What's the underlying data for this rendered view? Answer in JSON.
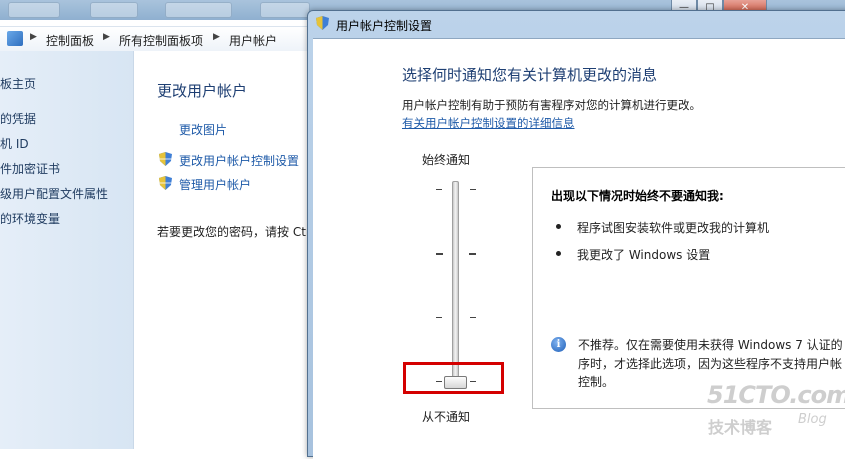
{
  "background_window": {
    "window_controls": {
      "minimize": "—",
      "maximize": "□",
      "close": "✕"
    },
    "breadcrumb": [
      "控制面板",
      "所有控制面板项",
      "用户帐户"
    ],
    "sidebar_items": [
      "板主页",
      "的凭据",
      "机 ID",
      "件加密证书",
      "级用户配置文件属性",
      "的环境变量"
    ],
    "main": {
      "heading": "更改用户帐户",
      "tasks": [
        "更改图片",
        "更改用户帐户控制设置",
        "管理用户帐户"
      ],
      "password_hint": "若要更改您的密码，请按 Ctrl"
    }
  },
  "uac_dialog": {
    "title": "用户帐户控制设置",
    "heading": "选择何时通知您有关计算机更改的消息",
    "description": "用户帐户控制有助于预防有害程序对您的计算机进行更改。",
    "link": "有关用户帐户控制设置的详细信息",
    "slider": {
      "top_label": "始终通知",
      "bottom_label": "从不通知",
      "levels": 4,
      "selected_level": 1
    },
    "info_panel": {
      "title": "出现以下情况时始终不要通知我:",
      "bullets": [
        "程序试图安装软件或更改我的计算机",
        "我更改了 Windows 设置"
      ],
      "note_lines": [
        "不推荐。仅在需要使用未获得 Windows 7 认证的",
        "序时，才选择此选项，因为这些程序不支持用户帐",
        "控制。"
      ]
    }
  },
  "watermark": {
    "logo": "51CTO.com",
    "subtitle": "技术博客",
    "blog": "Blog"
  },
  "colors": {
    "link": "#1e5aa8",
    "heading": "#1e3f73",
    "highlight": "#d40000"
  }
}
